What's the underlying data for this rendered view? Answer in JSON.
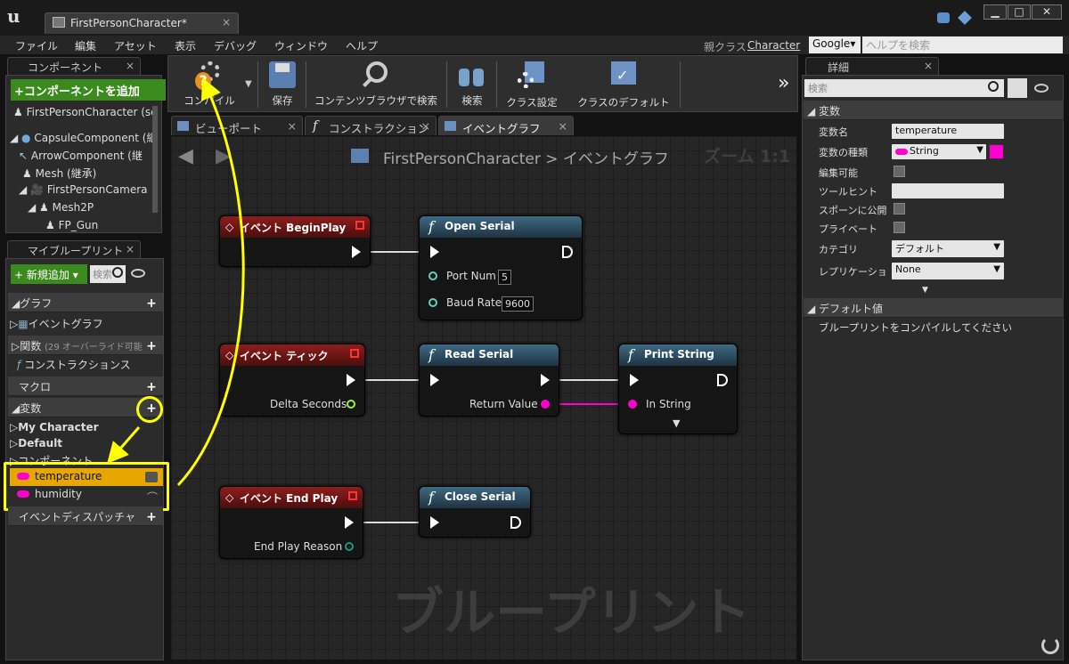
{
  "window": {
    "tab_title": "FirstPersonCharacter*",
    "close_glyph": "×",
    "min_glyph": "▁",
    "max_glyph": "□",
    "win_close_glyph": "✕"
  },
  "menubar": {
    "items": [
      "ファイル",
      "編集",
      "アセット",
      "表示",
      "デバッグ",
      "ウィンドウ",
      "ヘルプ"
    ],
    "parent_class_label": "親クラス",
    "parent_class_value": "Character",
    "search_provider": "Google▾",
    "help_search_placeholder": "ヘルプを検索"
  },
  "components": {
    "tab_label": "コンポーネント",
    "add_button": "+コンポーネントを追加",
    "tree": [
      "FirstPersonCharacter (se",
      "CapsuleComponent (継",
      "ArrowComponent (継",
      "Mesh (継承)",
      "FirstPersonCamera",
      "Mesh2P",
      "FP_Gun"
    ]
  },
  "my_blueprint": {
    "tab_label": "マイブループリント",
    "new_button": "新規追加",
    "search_placeholder": "検索",
    "sections": {
      "graph": "グラフ",
      "graph_item": "イベントグラフ",
      "functions": "関数",
      "functions_note": "(29 オーバーライド可能",
      "construction_item": "コンストラクションス",
      "macros": "マクロ",
      "variables": "変数",
      "my_character": "My Character",
      "default": "Default",
      "components_cat": "コンポーネント",
      "var_temperature": "temperature",
      "var_humidity": "humidity",
      "event_dispatchers": "イベントディスパッチャ"
    }
  },
  "toolbar": {
    "compile": "コンパイル",
    "save": "保存",
    "browse": "コンテンツブラウザで検索",
    "find": "検索",
    "class_settings": "クラス設定",
    "class_defaults": "クラスのデフォルト",
    "more": "»"
  },
  "graph_tabs": {
    "viewport": "ビューポート",
    "construction": "コンストラクション",
    "event_graph": "イベントグラフ"
  },
  "graph": {
    "breadcrumb_bp": "FirstPersonCharacter",
    "breadcrumb_sep": ">",
    "breadcrumb_graph": "イベントグラフ",
    "zoom": "ズーム 1:1",
    "watermark": "ブループリント",
    "nodes": {
      "begin_play": "イベント BeginPlay",
      "open_serial": "Open Serial",
      "port_num_label": "Port Num",
      "port_num_value": "5",
      "baud_rate_label": "Baud Rate",
      "baud_rate_value": "9600",
      "tick": "イベント ティック",
      "delta_seconds": "Delta Seconds",
      "read_serial": "Read Serial",
      "return_value": "Return Value",
      "print_string": "Print String",
      "in_string": "In String",
      "end_play": "イベント End Play",
      "end_play_reason": "End Play Reason",
      "close_serial": "Close Serial",
      "func_glyph": "f"
    }
  },
  "details": {
    "tab_label": "詳細",
    "search_placeholder": "検索",
    "section_variable": "変数",
    "var_name_label": "変数名",
    "var_name_value": "temperature",
    "var_type_label": "変数の種類",
    "var_type_value": "String",
    "editable_label": "編集可能",
    "tooltip_label": "ツールヒント",
    "expose_label": "スポーンに公開",
    "private_label": "プライベート",
    "category_label": "カテゴリ",
    "category_value": "デフォルト",
    "replication_label": "レプリケーショ",
    "replication_value": "None",
    "section_default": "デフォルト値",
    "default_message": "ブループリントをコンパイルしてください"
  },
  "colors": {
    "accent_yellow": "#ffff00",
    "string_pin": "#ff00d0",
    "event_header": "#8e1d1d",
    "function_header": "#3e6a84",
    "selected_row": "#e6a800"
  }
}
